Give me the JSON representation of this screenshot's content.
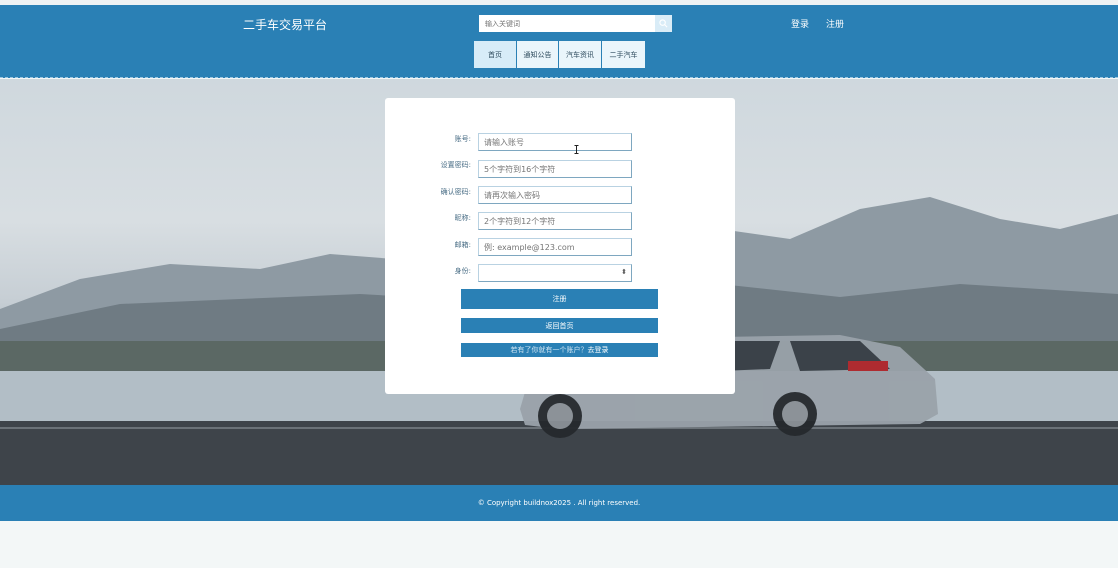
{
  "header": {
    "site_title": "二手车交易平台",
    "search_placeholder": "输入关键词",
    "login": "登录",
    "register": "注册",
    "nav": [
      "首页",
      "通知公告",
      "汽车资讯",
      "二手汽车"
    ]
  },
  "form": {
    "account_label": "账号:",
    "account_placeholder": "请输入账号",
    "password_label": "设置密码:",
    "password_placeholder": "5个字符到16个字符",
    "confirm_label": "确认密码:",
    "confirm_placeholder": "请再次输入密码",
    "nickname_label": "昵称:",
    "nickname_placeholder": "2个字符到12个字符",
    "email_label": "邮箱:",
    "email_placeholder": "例: example@123.com",
    "role_label": "身份:",
    "role_value": "",
    "register_button": "注册",
    "back_button": "返回首页",
    "login_link_prefix": "若有了你就有一个账户？",
    "login_link": "去登录"
  },
  "footer": {
    "copyright": "© Copyright buildnox2025 . All right reserved."
  },
  "colors": {
    "primary": "#2a80b5",
    "nav_bg": "#eaf5fb",
    "page_bg": "#f3f7f7"
  }
}
